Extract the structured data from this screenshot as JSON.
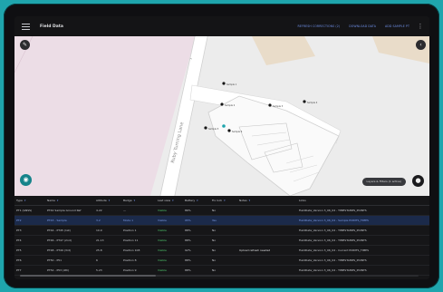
{
  "app": {
    "title": "Field Data",
    "top_links": [
      "REFRESH CORRECTIONS (2)",
      "DOWNLOAD DATA",
      "ADD SAMPLE PT"
    ]
  },
  "map": {
    "street_label": "Ruby Turning Lane",
    "points": [
      {
        "label": "Sample 1"
      },
      {
        "label": "Sample 2"
      },
      {
        "label": "Sample 3"
      },
      {
        "label": "Sample 4"
      },
      {
        "label": "Sample 5"
      },
      {
        "label": "Sample 6"
      },
      {
        "label": "Sample 7"
      }
    ],
    "chip_label": "Layers & Filters (1 active)",
    "drag_label": "≡"
  },
  "table": {
    "columns": [
      "Type",
      "Name",
      "Altitude",
      "Badge",
      "Last view",
      "Battery",
      "Fix lock",
      "Notes",
      "Links"
    ],
    "rows": [
      {
        "type": "PT1 (GNSS)",
        "name": "PT42 Sample Ground Ref",
        "alt": "4.22",
        "badge": "—",
        "last": "Visible",
        "battery": "86%",
        "fix": "No",
        "notes": "",
        "links": "FieldData_Version 3_06_04 - TIMESTAMPS_POINTS"
      },
      {
        "type": "PT2",
        "name": "PT43 - Sample",
        "alt": "3.2",
        "badge": "Mode 1",
        "last": "Visible",
        "battery": "95%",
        "fix": "Yes",
        "notes": "",
        "links": "FieldData_Version 3_06_04 - Sample POINTS_TIMES",
        "selected": true
      },
      {
        "type": "PT3",
        "name": "PT44 - PT45 (1st)",
        "alt": "10.9",
        "badge": "Position 1",
        "last": "Visible",
        "battery": "88%",
        "fix": "No",
        "notes": "",
        "links": "FieldData_Version 3_06_04 - TIMESTAMPS_POINTS"
      },
      {
        "type": "PT4",
        "name": "PT46 - PT47 (2nd)",
        "alt": "21.13",
        "badge": "Position 11",
        "last": "Visible",
        "battery": "88%",
        "fix": "No",
        "notes": "",
        "links": "FieldData_Version 3_06_04 - TIMESTAMPS_POINTS"
      },
      {
        "type": "PT5",
        "name": "PT48 - PT49 (3rd)",
        "alt": "25.8",
        "badge": "Position 108",
        "last": "Visible",
        "battery": "92%",
        "fix": "No",
        "notes": "Upload refresh needed",
        "links": "FieldData_Version 3_06_04 - Current POINTS_TIMES"
      },
      {
        "type": "PT6",
        "name": "PT50 - P51",
        "alt": "6",
        "badge": "Position 8",
        "last": "Visible",
        "battery": "88%",
        "fix": "No",
        "notes": "",
        "links": "FieldData_Version 3_06_04 - TIMESTAMPS_POINTS"
      },
      {
        "type": "PT7",
        "name": "PT52 - P53 (4th)",
        "alt": "5.23",
        "badge": "Position 9",
        "last": "Visible",
        "battery": "88%",
        "fix": "No",
        "notes": "",
        "links": "FieldData_Version 3_06_04 - TIMESTAMPS_POINTS"
      }
    ]
  },
  "colors": {
    "accent": "#6f8fe6",
    "status_ok": "#4fca6d",
    "frame": "#1fa5ad"
  }
}
